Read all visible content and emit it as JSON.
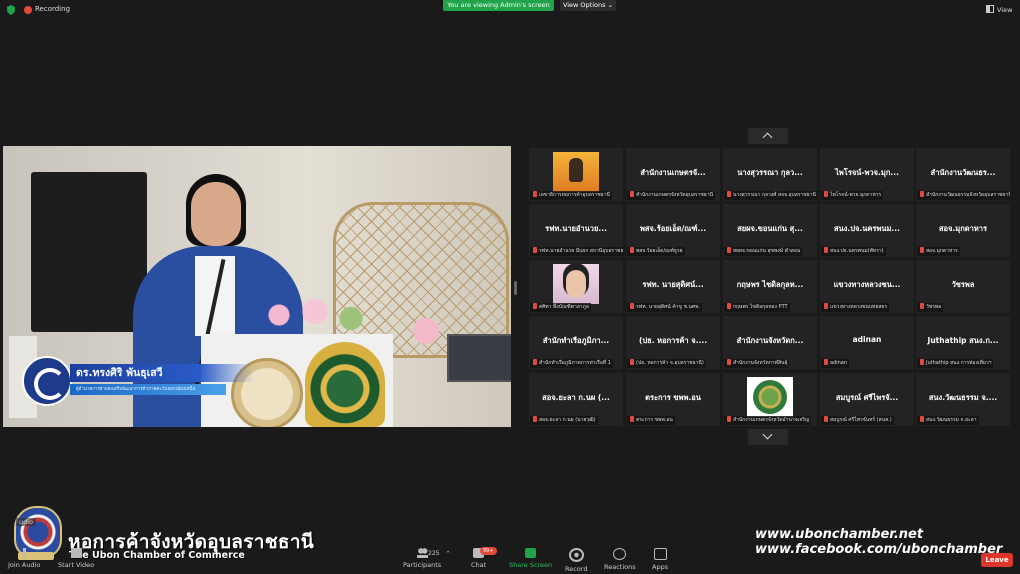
{
  "top": {
    "recording": "Recording",
    "viewing_banner": "You are viewing Admin's screen",
    "view_options": "View Options",
    "view": "View"
  },
  "speaker": {
    "name": "ดร.ทรงศิริ พันธุเสวี",
    "role": "ผู้อำนวยการฝ่ายส่งเสริมพัฒนาการค้าภาคตะวันออกเฉียงเหนือ"
  },
  "gallery": [
    {
      "tile": "",
      "label": "เลขาธิการหอการค้าอุบลราชธานี",
      "photo": "orange"
    },
    {
      "tile": "สำนักงานเกษตรจั...",
      "label": "สำนักงานเกษตรจังหวัดอุบลราชธานี",
      "photo": ""
    },
    {
      "tile": "นางสุวรรณา กุลว...",
      "label": "นางสุวรรณา กุลวงศ์ สจจ.อุบลราชธานี",
      "photo": ""
    },
    {
      "tile": "ไพโรจน์-พวจ.มุก...",
      "label": "ไพโรจน์-พวจ.มุกดาหาร",
      "photo": ""
    },
    {
      "tile": "สำนักงานวัฒนธร...",
      "label": "สำนักงานวัฒนธรรมจังหวัดอุบลราชธานี",
      "photo": ""
    },
    {
      "tile": "รฟท.นายอำนวย...",
      "label": "รฟท.นายอำนวย มีแผก สถานีอุบลราชธานี",
      "photo": ""
    },
    {
      "tile": "พสจ.ร้อยเอ็ด/ณฑ์...",
      "label": "พสจ.ร้อยเอ็ด/ณฑ์ธูรธ",
      "photo": ""
    },
    {
      "tile": "สยผจ.ขอนแก่น สุ...",
      "label": "สยผจ.ขอนแก่น สุขพงษ์ คำสอน",
      "photo": ""
    },
    {
      "tile": "สนง.ปจ.นครพนม...",
      "label": "สนง.ปจ.นครพนม(พัทรา)",
      "photo": ""
    },
    {
      "tile": "สอจ.มุกดาหาร",
      "label": "สอจ.มุกดาหาร",
      "photo": ""
    },
    {
      "tile": "",
      "label": "ศศิตา พึ่งบัณฑิตาลาภูล",
      "photo": "portrait"
    },
    {
      "tile": "รฟท. นายสุดิศน์...",
      "label": "รฟท. นายสุดิศน์ ค้าขู ช.นศท.",
      "photo": ""
    },
    {
      "tile": "กฤษพร ไชดิลกุลห...",
      "label": "กฤษพร ไชดิลกุลหอง PTT",
      "photo": ""
    },
    {
      "tile": "แขวงทางหลวงชน...",
      "label": "แขวงทางหลวงชนบทยสธร",
      "photo": ""
    },
    {
      "tile": "วัชรพล",
      "label": "วัชรพล",
      "photo": ""
    },
    {
      "tile": "สำนักทำเรือภูมิภา...",
      "label": "สำนักทำเรือภูมิภาคการท่าเรือที่ 1",
      "photo": ""
    },
    {
      "tile": "(ปธ. หอการค้า จ....",
      "label": "(ปธ. หอการค้า จ.อุบลราชธานี)",
      "photo": ""
    },
    {
      "tile": "สำนักงานจังหวัดก...",
      "label": "สำนักงานจังหวัดกาฬสินธุ์",
      "photo": ""
    },
    {
      "tile": "adinan",
      "label": "adinan",
      "photo": ""
    },
    {
      "tile": "Juthathip สนง.ก...",
      "label": "Juthathip สนง.การท่องเที่ยวฯ",
      "photo": ""
    },
    {
      "tile": "สอจ.ยะลา ก.นผ (...",
      "label": "สอจ.ยะลา ก.นผ (นายวุฒิ)",
      "photo": ""
    },
    {
      "tile": "ตระการ ขพพ.อน",
      "label": "ตระการ ขพพ.อน",
      "photo": ""
    },
    {
      "tile": "",
      "label": "สำนักงานเกษตรจังหวัดอำนาจเจริญ",
      "photo": "emblem"
    },
    {
      "tile": "สมบูรณ์ ศรีไพรจั...",
      "label": "สมบูรณ์ ศรีไพรจันทร์ (สนส.)",
      "photo": ""
    },
    {
      "tile": "สนง.วัฒนธรรม จ....",
      "label": "สนง.วัฒนธรรม จ.ยะลา",
      "photo": ""
    }
  ],
  "branding": {
    "thai_name": "หอการค้าจังหวัดอุบลราชธานี",
    "english_name": "The Ubon Chamber of Commerce",
    "website": "www.ubonchamber.net",
    "facebook": "www.facebook.com/ubonchamber"
  },
  "toolbar": {
    "audio_overlay": "udio",
    "join_audio": "Join Audio",
    "start_video": "Start Video",
    "participants": "Participants",
    "participant_count": "225",
    "chat": "Chat",
    "chat_badge": "99+",
    "share_screen": "Share Screen",
    "record": "Record",
    "reactions": "Reactions",
    "apps": "Apps",
    "leave": "Leave"
  }
}
